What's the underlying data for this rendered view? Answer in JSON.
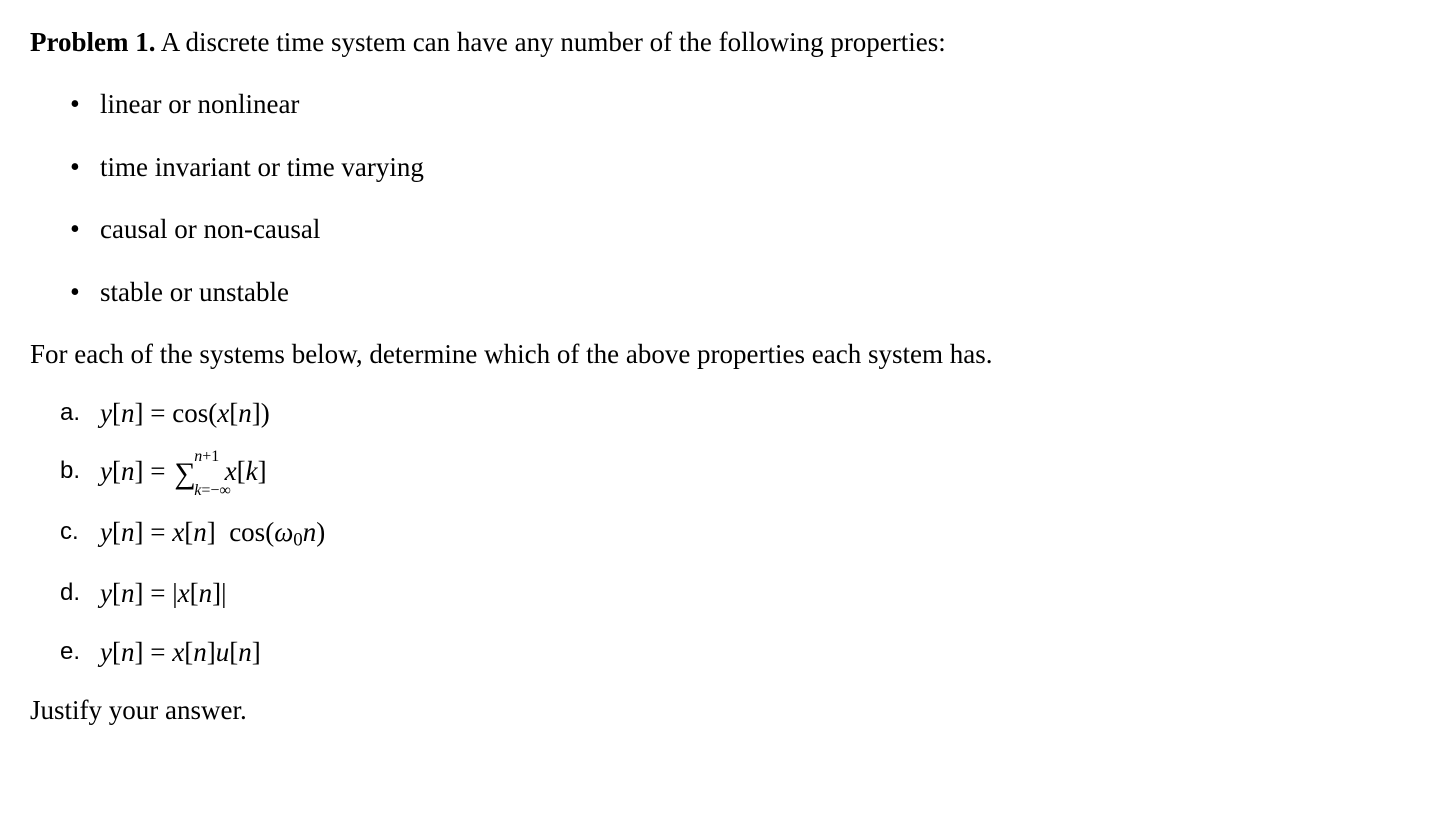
{
  "header": {
    "label": "Problem 1.",
    "intro": "A discrete time system can have any number of the following properties:"
  },
  "bullets": [
    "linear or nonlinear",
    "time invariant or time varying",
    "causal or non-causal",
    "stable or unstable"
  ],
  "instruction": "For each of the systems below, determine which of the above properties each system has.",
  "items": [
    {
      "label": "a."
    },
    {
      "label": "b."
    },
    {
      "label": "c."
    },
    {
      "label": "d."
    },
    {
      "label": "e."
    }
  ],
  "equations": {
    "a": {
      "lhs_var": "y",
      "lhs_index": "n",
      "func": "cos",
      "arg_var": "x",
      "arg_index": "n"
    },
    "b": {
      "lhs_var": "y",
      "lhs_index": "n",
      "sum_upper_var": "n",
      "sum_upper_plus": "+1",
      "sum_lower_var": "k",
      "sum_lower_eq": "=−∞",
      "term_var": "x",
      "term_index": "k"
    },
    "c": {
      "lhs_var": "y",
      "lhs_index": "n",
      "fac_var": "x",
      "fac_index": "n",
      "func": "cos",
      "omega": "ω",
      "sub0": "0",
      "nvar": "n"
    },
    "d": {
      "lhs_var": "y",
      "lhs_index": "n",
      "abs_var": "x",
      "abs_index": "n"
    },
    "e": {
      "lhs_var": "y",
      "lhs_index": "n",
      "fac1_var": "x",
      "fac1_index": "n",
      "fac2_var": "u",
      "fac2_index": "n"
    }
  },
  "justify": "Justify your answer."
}
